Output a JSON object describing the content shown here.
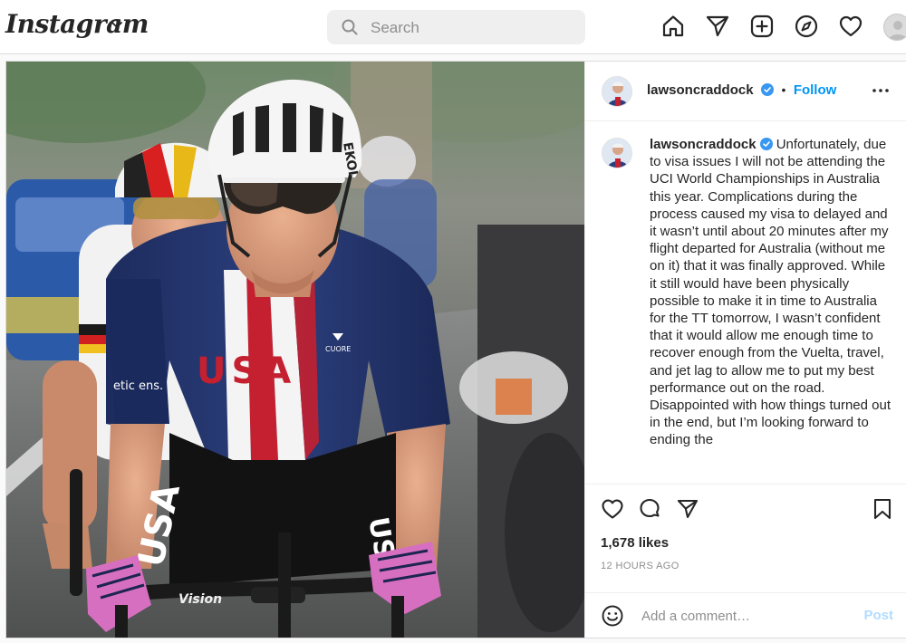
{
  "app": {
    "logo_text": "Instagram"
  },
  "search": {
    "placeholder": "Search"
  },
  "nav": {
    "icons": [
      "home-icon",
      "direct-send-icon",
      "new-post-icon",
      "explore-compass-icon",
      "activity-heart-icon",
      "profile-avatar"
    ]
  },
  "post": {
    "username": "lawsoncraddock",
    "verified": true,
    "follow_label": "Follow",
    "separator": "•",
    "caption": "Unfortunately, due to visa issues I will not be attending the UCI World Championships in Australia this year. Complications during the process caused my visa to delayed and it wasn’t until about 20 minutes after my flight departed for Australia (without me on it) that it was finally approved. While it still would have been physically possible to make it in time to Australia for the TT tomorrow, I wasn’t confident that it would allow me enough time to recover enough from the Vuelta, travel, and jet lag to allow me to put my best performance out on the road. Disappointed with how things turned out in the end, but I’m looking forward to ending the",
    "likes": "1,678 likes",
    "timestamp": "12 HOURS AGO",
    "comment_placeholder": "Add a comment…",
    "post_label": "Post",
    "photo": {
      "jersey_text": "USA",
      "jersey_brand": "CUORE",
      "handlebar_text": "Vision",
      "helmet_text": "EKOI",
      "sleeve_text": "etic ens."
    }
  },
  "colors": {
    "accent": "#0095f6",
    "verified": "#3897f0",
    "border": "#dbdbdb"
  }
}
